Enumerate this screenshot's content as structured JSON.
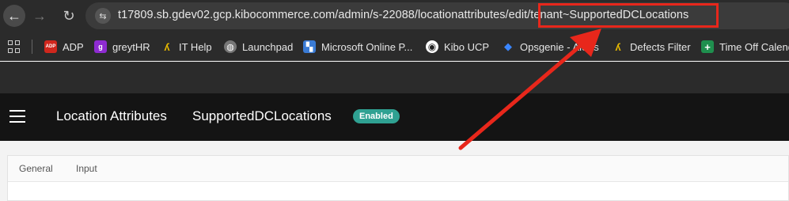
{
  "browser": {
    "url": "t17809.sb.gdev02.gcp.kibocommerce.com/admin/s-22088/locationattributes/edit/tenant~SupportedDCLocations",
    "back_icon": "←",
    "forward_icon": "→",
    "reload_icon": "↻",
    "site_info_icon": "⇆"
  },
  "bookmarks": [
    {
      "label": "ADP",
      "icon": "adp-icon",
      "icon_text": "ADP",
      "color": "#d0271d"
    },
    {
      "label": "greytHR",
      "icon": "greythr-icon",
      "icon_text": "g",
      "color": "#8e2bd1"
    },
    {
      "label": "IT Help",
      "icon": "it-help-icon",
      "icon_text": "ʎ",
      "color": "#e6b800"
    },
    {
      "label": "Launchpad",
      "icon": "globe-icon",
      "icon_text": "◍",
      "color": "#777777"
    },
    {
      "label": "Microsoft Online P...",
      "icon": "microsoft-icon",
      "icon_text": "▚",
      "color": "#3a7bd5"
    },
    {
      "label": "Kibo UCP",
      "icon": "github-icon",
      "icon_text": "◉",
      "color": "#2b2b2b"
    },
    {
      "label": "Opsgenie - Alerts",
      "icon": "opsgenie-icon",
      "icon_text": "◆",
      "color": "#2f6fde"
    },
    {
      "label": "Defects Filter",
      "icon": "jira-icon",
      "icon_text": "ʎ",
      "color": "#e6b800"
    },
    {
      "label": "Time Off Calendar",
      "icon": "sheets-icon",
      "icon_text": "+",
      "color": "#1f8f4e"
    }
  ],
  "app": {
    "title": "Location Attributes",
    "subtitle": "SupportedDCLocations",
    "status_badge": "Enabled",
    "accent_color": "#2fa192"
  },
  "tabs": [
    "General",
    "Input"
  ],
  "annotation": {
    "highlight_color": "#e8271b"
  }
}
